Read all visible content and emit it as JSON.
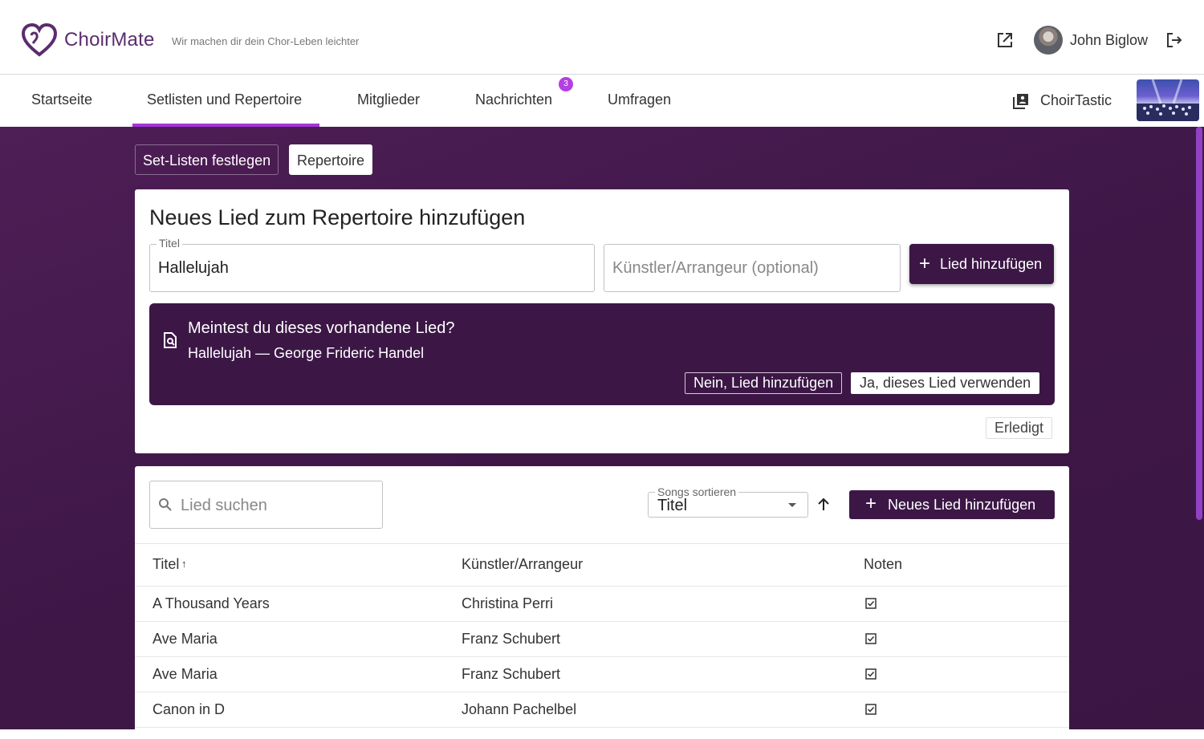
{
  "header": {
    "app_name": "ChoirMate",
    "tagline": "Wir machen dir dein Chor-Leben leichter",
    "user_name": "John Biglow",
    "icons": [
      "heart-logo-icon",
      "external-link-icon",
      "logout-icon"
    ]
  },
  "nav": {
    "tabs": [
      {
        "label": "Startseite"
      },
      {
        "label": "Setlisten und Repertoire",
        "active": true
      },
      {
        "label": "Mitglieder"
      },
      {
        "label": "Nachrichten",
        "badge": "3"
      },
      {
        "label": "Umfragen"
      }
    ],
    "choir_name": "ChoirTastic",
    "accent_color": "#a335d8"
  },
  "subtabs": {
    "setlists": "Set-Listen festlegen",
    "repertoire": "Repertoire"
  },
  "add_form": {
    "title": "Neues Lied zum Repertoire hinzufügen",
    "title_field_label": "Titel",
    "title_field_value": "Hallelujah",
    "artist_placeholder": "Künstler/Arrangeur (optional)",
    "add_button": "Lied hinzufügen",
    "suggestion": {
      "question": "Meintest du dieses vorhandene Lied?",
      "song": "Hallelujah — George Frideric Handel",
      "no_button": "Nein, Lied hinzufügen",
      "yes_button": "Ja, dieses Lied verwenden"
    },
    "done_button": "Erledigt"
  },
  "repertoire": {
    "search_placeholder": "Lied suchen",
    "sort_label": "Songs sortieren",
    "sort_value": "Titel",
    "new_song_button": "Neues Lied hinzufügen",
    "columns": [
      "Titel",
      "Künstler/Arrangeur",
      "Noten"
    ],
    "rows": [
      {
        "title": "A Thousand Years",
        "artist": "Christina Perri",
        "sheet_music": true
      },
      {
        "title": "Ave Maria",
        "artist": "Franz Schubert",
        "sheet_music": true
      },
      {
        "title": "Ave Maria",
        "artist": "Franz Schubert",
        "sheet_music": true
      },
      {
        "title": "Canon in D",
        "artist": "Johann Pachelbel",
        "sheet_music": true
      }
    ]
  },
  "colors": {
    "brand_purple": "#3c1746",
    "background_purple": "#4e1e56",
    "badge": "#b43fe2"
  }
}
